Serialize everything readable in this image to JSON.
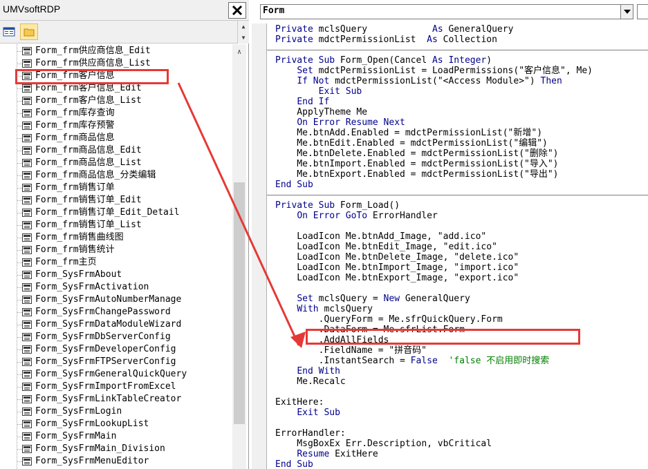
{
  "left_panel": {
    "title": "UMVsoftRDP",
    "tree_items": [
      "Form_frm供应商信息_Edit",
      "Form_frm供应商信息_List",
      "Form_frm客户信息",
      "Form_frm客户信息_Edit",
      "Form_frm客户信息_List",
      "Form_frm库存查询",
      "Form_frm库存预警",
      "Form_frm商品信息",
      "Form_frm商品信息_Edit",
      "Form_frm商品信息_List",
      "Form_frm商品信息_分类编辑",
      "Form_frm销售订单",
      "Form_frm销售订单_Edit",
      "Form_frm销售订单_Edit_Detail",
      "Form_frm销售订单_List",
      "Form_frm销售曲线图",
      "Form_frm销售统计",
      "Form_frm主页",
      "Form_SysFrmAbout",
      "Form_SysFrmActivation",
      "Form_SysFrmAutoNumberManage",
      "Form_SysFrmChangePassword",
      "Form_SysFrmDataModuleWizard",
      "Form_SysFrmDbServerConfig",
      "Form_SysFrmDeveloperConfig",
      "Form_SysFrmFTPServerConfig",
      "Form_SysFrmGeneralQuickQuery",
      "Form_SysFrmImportFromExcel",
      "Form_SysFrmLinkTableCreator",
      "Form_SysFrmLogin",
      "Form_SysFrmLookupList",
      "Form_SysFrmMain",
      "Form_SysFrmMain_Division",
      "Form_SysFrmMenuEditor"
    ],
    "highlighted_item": "Form_frm客户信息"
  },
  "editor": {
    "object_combo": "Form",
    "lines": [
      [
        [
          "k",
          "Private "
        ],
        [
          "t",
          "mclsQuery            "
        ],
        [
          "k",
          "As "
        ],
        [
          "t",
          "GeneralQuery"
        ]
      ],
      [
        [
          "k",
          "Private "
        ],
        [
          "t",
          "mdctPermissionList  "
        ],
        [
          "k",
          "As "
        ],
        [
          "t",
          "Collection"
        ]
      ],
      [],
      [
        [
          "k",
          "Private Sub "
        ],
        [
          "t",
          "Form_Open(Cancel "
        ],
        [
          "k",
          "As Integer"
        ],
        [
          "t",
          ")"
        ]
      ],
      [
        [
          "t",
          "    "
        ],
        [
          "k",
          "Set "
        ],
        [
          "t",
          "mdctPermissionList = LoadPermissions(\"客户信息\", Me)"
        ]
      ],
      [
        [
          "t",
          "    "
        ],
        [
          "k",
          "If Not "
        ],
        [
          "t",
          "mdctPermissionList(\"<Access Module>\") "
        ],
        [
          "k",
          "Then"
        ]
      ],
      [
        [
          "t",
          "        "
        ],
        [
          "k",
          "Exit Sub"
        ]
      ],
      [
        [
          "t",
          "    "
        ],
        [
          "k",
          "End If"
        ]
      ],
      [
        [
          "t",
          "    ApplyTheme Me"
        ]
      ],
      [
        [
          "t",
          "    "
        ],
        [
          "k",
          "On Error Resume Next"
        ]
      ],
      [
        [
          "t",
          "    Me.btnAdd.Enabled = mdctPermissionList(\"新增\")"
        ]
      ],
      [
        [
          "t",
          "    Me.btnEdit.Enabled = mdctPermissionList(\"编辑\")"
        ]
      ],
      [
        [
          "t",
          "    Me.btnDelete.Enabled = mdctPermissionList(\"删除\")"
        ]
      ],
      [
        [
          "t",
          "    Me.btnImport.Enabled = mdctPermissionList(\"导入\")"
        ]
      ],
      [
        [
          "t",
          "    Me.btnExport.Enabled = mdctPermissionList(\"导出\")"
        ]
      ],
      [
        [
          "k",
          "End Sub"
        ]
      ],
      [],
      [
        [
          "k",
          "Private Sub "
        ],
        [
          "t",
          "Form_Load()"
        ]
      ],
      [
        [
          "t",
          "    "
        ],
        [
          "k",
          "On Error GoTo "
        ],
        [
          "t",
          "ErrorHandler"
        ]
      ],
      [],
      [
        [
          "t",
          "    LoadIcon Me.btnAdd_Image, \"add.ico\""
        ]
      ],
      [
        [
          "t",
          "    LoadIcon Me.btnEdit_Image, \"edit.ico\""
        ]
      ],
      [
        [
          "t",
          "    LoadIcon Me.btnDelete_Image, \"delete.ico\""
        ]
      ],
      [
        [
          "t",
          "    LoadIcon Me.btnImport_Image, \"import.ico\""
        ]
      ],
      [
        [
          "t",
          "    LoadIcon Me.btnExport_Image, \"export.ico\""
        ]
      ],
      [],
      [
        [
          "t",
          "    "
        ],
        [
          "k",
          "Set "
        ],
        [
          "t",
          "mclsQuery = "
        ],
        [
          "k",
          "New "
        ],
        [
          "t",
          "GeneralQuery"
        ]
      ],
      [
        [
          "t",
          "    "
        ],
        [
          "k",
          "With "
        ],
        [
          "t",
          "mclsQuery"
        ]
      ],
      [
        [
          "t",
          "        .QueryForm = Me.sfrQuickQuery.Form"
        ]
      ],
      [
        [
          "t",
          "        .DataForm = Me.sfrList.Form"
        ]
      ],
      [
        [
          "t",
          "        .AddAllFields"
        ]
      ],
      [
        [
          "t",
          "        .FieldName = \"拼音码\""
        ]
      ],
      [
        [
          "t",
          "        .InstantSearch = "
        ],
        [
          "k",
          "False  "
        ],
        [
          "c",
          "'false 不启用即时搜索"
        ]
      ],
      [
        [
          "t",
          "    "
        ],
        [
          "k",
          "End With"
        ]
      ],
      [
        [
          "t",
          "    Me.Recalc"
        ]
      ],
      [],
      [
        [
          "t",
          "ExitHere:"
        ]
      ],
      [
        [
          "t",
          "    "
        ],
        [
          "k",
          "Exit Sub"
        ]
      ],
      [],
      [
        [
          "t",
          "ErrorHandler:"
        ]
      ],
      [
        [
          "t",
          "    MsgBoxEx Err.Description, vbCritical"
        ]
      ],
      [
        [
          "t",
          "    "
        ],
        [
          "k",
          "Resume "
        ],
        [
          "t",
          "ExitHere"
        ]
      ],
      [
        [
          "k",
          "End Sub"
        ]
      ]
    ]
  },
  "colors": {
    "keyword": "#00008b",
    "comment": "#008000",
    "annotation": "#e53935"
  }
}
